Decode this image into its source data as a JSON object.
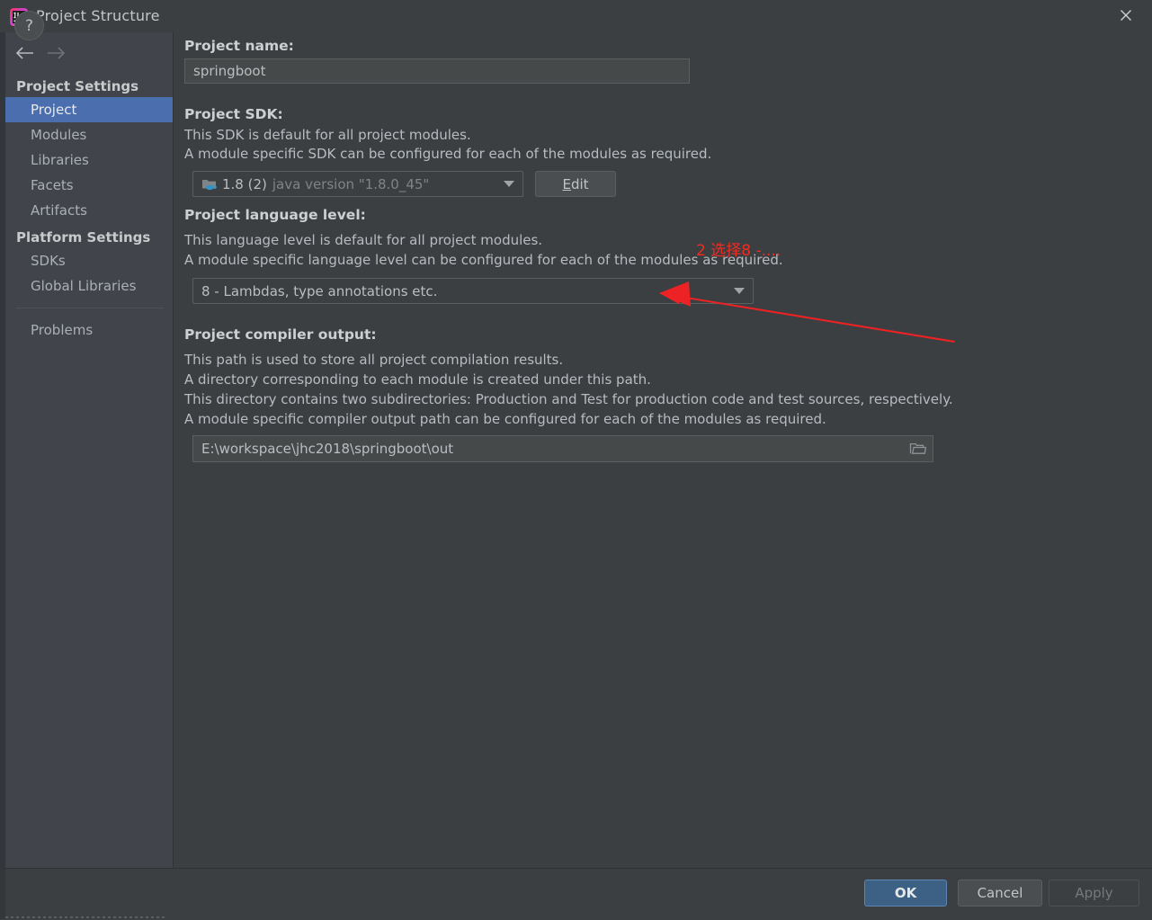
{
  "window": {
    "title": "Project Structure",
    "app_icon": "intellij-idea-icon",
    "close_icon": "close-icon"
  },
  "sidebar": {
    "nav": {
      "back_icon": "arrow-left-icon",
      "forward_icon": "arrow-right-icon"
    },
    "groups": [
      {
        "label": "Project Settings",
        "items": [
          {
            "label": "Project",
            "selected": true
          },
          {
            "label": "Modules",
            "selected": false
          },
          {
            "label": "Libraries",
            "selected": false
          },
          {
            "label": "Facets",
            "selected": false
          },
          {
            "label": "Artifacts",
            "selected": false
          }
        ]
      },
      {
        "label": "Platform Settings",
        "items": [
          {
            "label": "SDKs",
            "selected": false
          },
          {
            "label": "Global Libraries",
            "selected": false
          }
        ]
      }
    ],
    "extra_items": [
      {
        "label": "Problems",
        "selected": false
      }
    ]
  },
  "main": {
    "project_name": {
      "label": "Project name:",
      "value": "springboot",
      "placeholder": ""
    },
    "project_sdk": {
      "label": "Project SDK:",
      "desc_lines": [
        "This SDK is default for all project modules.",
        "A module specific SDK can be configured for each of the modules as required."
      ],
      "icon": "java-sdk-folder-icon",
      "value": "1.8 (2)",
      "value_detail": "java version \"1.8.0_45\"",
      "dropdown_icon": "chevron-down-icon",
      "edit_button": {
        "mnemonic": "E",
        "rest": "dit"
      }
    },
    "language_level": {
      "label": "Project language level:",
      "desc_lines": [
        "This language level is default for all project modules.",
        "A module specific language level can be configured for each of the modules as required."
      ],
      "value": "8 - Lambdas, type annotations etc.",
      "dropdown_icon": "chevron-down-icon"
    },
    "compiler_output": {
      "label": "Project compiler output:",
      "desc_lines": [
        "This path is used to store all project compilation results.",
        "A directory corresponding to each module is created under this path.",
        "This directory contains two subdirectories: Production and Test for production code and test sources, respectively.",
        "A module specific compiler output path can be configured for each of the modules as required."
      ],
      "value": "E:\\workspace\\jhc2018\\springboot\\out",
      "browse_icon": "folder-open-icon"
    }
  },
  "annotation": {
    "text": "2 选择8 -....",
    "color": "#f22a20",
    "arrow_icon": "red-arrow-icon"
  },
  "footer": {
    "help_icon": "?",
    "buttons": {
      "ok": "OK",
      "cancel": "Cancel",
      "apply": "Apply"
    }
  },
  "colors": {
    "background": "#3c3f41",
    "sidebar": "#41454b",
    "selection": "#4b6eaf",
    "accent_ok": "#3d6185",
    "annotation_red": "#f22a20",
    "text": "#b9bec3"
  }
}
